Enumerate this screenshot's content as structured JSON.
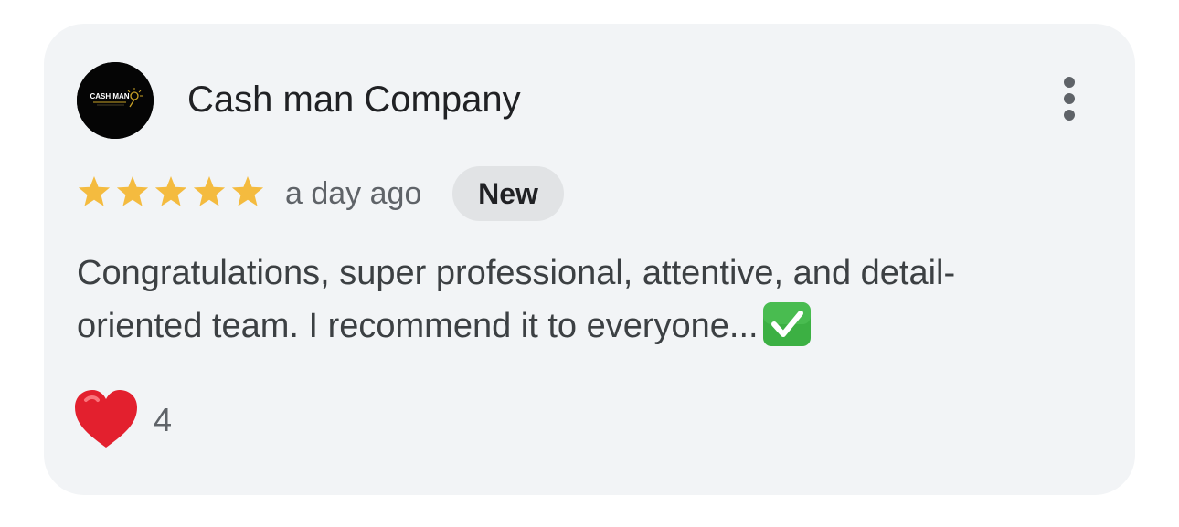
{
  "review": {
    "reviewer_name": "Cash man Company",
    "avatar": {
      "logo_text": "CASH MAN",
      "background_color": "#050505",
      "accent_color": "#c9a227"
    },
    "menu_icon": "more-vertical-icon",
    "rating": {
      "value": 5,
      "max": 5,
      "star_color": "#f4bb3f"
    },
    "date": "a day ago",
    "badge": "New",
    "text_line_1": "Congratulations, super professional, attentive, and detail-",
    "text_line_2": "oriented team. I recommend it to everyone...",
    "text_emoji": "check-mark-emoji",
    "reaction": {
      "icon": "heart-icon",
      "count": "4",
      "color": "#e3202e"
    }
  }
}
